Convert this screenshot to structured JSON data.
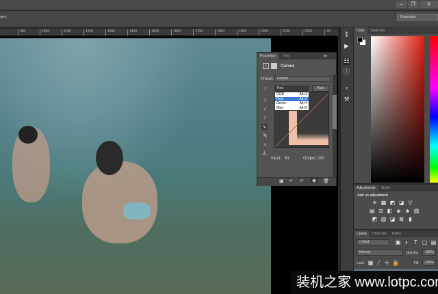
{
  "window": {
    "min": "–",
    "restore": "❐",
    "close": "X"
  },
  "optbar": {
    "tab_fragment": "yers",
    "workspace": "Essentials"
  },
  "ruler": [
    "900",
    "1000",
    "1100",
    "1200",
    "1300",
    "1400",
    "1500",
    "1600",
    "1700",
    "1800",
    "1900",
    "2000",
    "2100",
    "2200",
    "23"
  ],
  "properties": {
    "tabs": [
      "Properties",
      "Info"
    ],
    "title": "Curves",
    "preset_label": "Preset:",
    "preset_value": "Default",
    "channel": "Red",
    "auto": "Auto",
    "channels": [
      {
        "name": "RGB",
        "key": "Alt+2"
      },
      {
        "name": "Red",
        "key": "Alt+3"
      },
      {
        "name": "Green",
        "key": "Alt+4"
      },
      {
        "name": "Blue",
        "key": "Alt+5"
      }
    ],
    "input_label": "Input:",
    "input": "81",
    "output_label": "Output:",
    "output": "247"
  },
  "color": {
    "tabs": [
      "Color",
      "Swatches"
    ]
  },
  "adjustments": {
    "tabs": [
      "Adjustments",
      "Styles"
    ],
    "heading": "Add an adjustment"
  },
  "layers": {
    "tabs": [
      "Layers",
      "Channels",
      "Paths"
    ],
    "filter": "Kind",
    "blend": "Normal",
    "opacity_label": "Opacity:",
    "opacity": "100%",
    "lock_label": "Lock:",
    "fill_label": "Fill:",
    "fill": "100%"
  },
  "watermark": "装机之家 www.lotpc.com"
}
